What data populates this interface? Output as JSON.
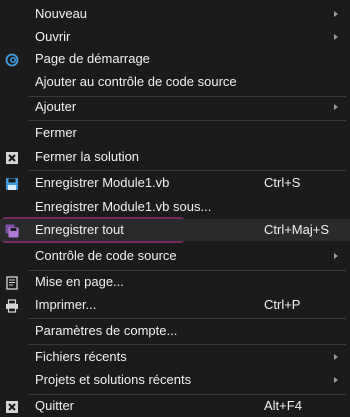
{
  "menu": {
    "items": [
      {
        "label": "Nouveau",
        "submenu": true
      },
      {
        "label": "Ouvrir",
        "submenu": true
      },
      {
        "label": "Page de démarrage",
        "icon": "start-page-icon"
      },
      {
        "label": "Ajouter au contrôle de code source"
      },
      {
        "label": "Ajouter",
        "submenu": true
      },
      {
        "label": "Fermer"
      },
      {
        "label": "Fermer la solution",
        "icon": "close-solution-icon"
      },
      {
        "label": "Enregistrer Module1.vb",
        "icon": "save-icon",
        "shortcut": "Ctrl+S"
      },
      {
        "label": "Enregistrer Module1.vb sous..."
      },
      {
        "label": "Enregistrer tout",
        "icon": "save-all-icon",
        "shortcut": "Ctrl+Maj+S"
      },
      {
        "label": "Contrôle de code source",
        "submenu": true
      },
      {
        "label": "Mise en page...",
        "icon": "page-setup-icon"
      },
      {
        "label": "Imprimer...",
        "icon": "print-icon",
        "shortcut": "Ctrl+P"
      },
      {
        "label": "Paramètres de compte..."
      },
      {
        "label": "Fichiers récents",
        "submenu": true
      },
      {
        "label": "Projets et solutions récents",
        "submenu": true
      },
      {
        "label": "Quitter",
        "icon": "exit-icon",
        "shortcut": "Alt+F4"
      }
    ]
  },
  "colors": {
    "background": "#1b1b1c",
    "text": "#f1f1f1",
    "separator": "#3a3a3c",
    "highlight": "#7d2a63",
    "save_icon": "#3fa0e0",
    "save_all_icon": "#b57ad6",
    "start_page_icon": "#3fa0e0"
  }
}
